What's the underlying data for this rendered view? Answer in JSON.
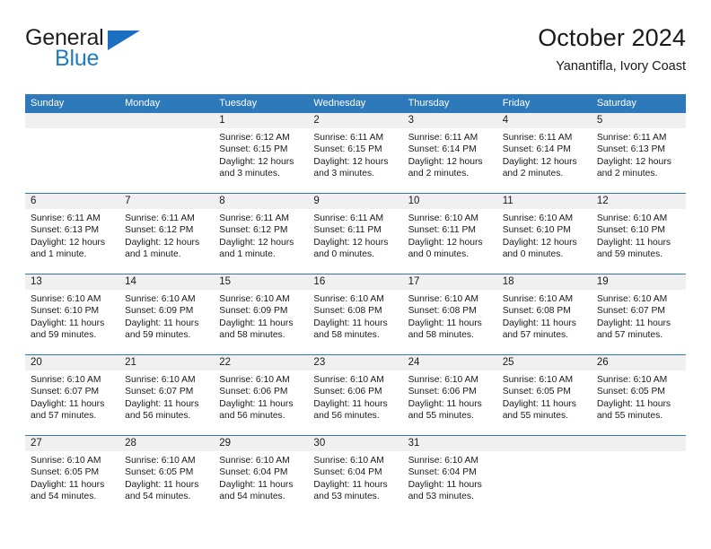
{
  "logo": {
    "word_top": "General",
    "word_bottom": "Blue",
    "triangle_icon": "triangle-icon"
  },
  "header": {
    "title": "October 2024",
    "subtitle": "Yanantifla, Ivory Coast"
  },
  "colors": {
    "header_blue": "#2e79b9",
    "logo_blue": "#1f7cc4",
    "day_band_gray": "#f0f0f0",
    "text": "#1a1a1a"
  },
  "weekdays": [
    "Sunday",
    "Monday",
    "Tuesday",
    "Wednesday",
    "Thursday",
    "Friday",
    "Saturday"
  ],
  "labels": {
    "sunrise_prefix": "Sunrise:",
    "sunset_prefix": "Sunset:",
    "daylight_prefix": "Daylight:"
  },
  "weeks": [
    [
      {
        "day": "",
        "lines": []
      },
      {
        "day": "",
        "lines": []
      },
      {
        "day": "1",
        "lines": [
          "Sunrise: 6:12 AM",
          "Sunset: 6:15 PM",
          "Daylight: 12 hours",
          "and 3 minutes."
        ]
      },
      {
        "day": "2",
        "lines": [
          "Sunrise: 6:11 AM",
          "Sunset: 6:15 PM",
          "Daylight: 12 hours",
          "and 3 minutes."
        ]
      },
      {
        "day": "3",
        "lines": [
          "Sunrise: 6:11 AM",
          "Sunset: 6:14 PM",
          "Daylight: 12 hours",
          "and 2 minutes."
        ]
      },
      {
        "day": "4",
        "lines": [
          "Sunrise: 6:11 AM",
          "Sunset: 6:14 PM",
          "Daylight: 12 hours",
          "and 2 minutes."
        ]
      },
      {
        "day": "5",
        "lines": [
          "Sunrise: 6:11 AM",
          "Sunset: 6:13 PM",
          "Daylight: 12 hours",
          "and 2 minutes."
        ]
      }
    ],
    [
      {
        "day": "6",
        "lines": [
          "Sunrise: 6:11 AM",
          "Sunset: 6:13 PM",
          "Daylight: 12 hours",
          "and 1 minute."
        ]
      },
      {
        "day": "7",
        "lines": [
          "Sunrise: 6:11 AM",
          "Sunset: 6:12 PM",
          "Daylight: 12 hours",
          "and 1 minute."
        ]
      },
      {
        "day": "8",
        "lines": [
          "Sunrise: 6:11 AM",
          "Sunset: 6:12 PM",
          "Daylight: 12 hours",
          "and 1 minute."
        ]
      },
      {
        "day": "9",
        "lines": [
          "Sunrise: 6:11 AM",
          "Sunset: 6:11 PM",
          "Daylight: 12 hours",
          "and 0 minutes."
        ]
      },
      {
        "day": "10",
        "lines": [
          "Sunrise: 6:10 AM",
          "Sunset: 6:11 PM",
          "Daylight: 12 hours",
          "and 0 minutes."
        ]
      },
      {
        "day": "11",
        "lines": [
          "Sunrise: 6:10 AM",
          "Sunset: 6:10 PM",
          "Daylight: 12 hours",
          "and 0 minutes."
        ]
      },
      {
        "day": "12",
        "lines": [
          "Sunrise: 6:10 AM",
          "Sunset: 6:10 PM",
          "Daylight: 11 hours",
          "and 59 minutes."
        ]
      }
    ],
    [
      {
        "day": "13",
        "lines": [
          "Sunrise: 6:10 AM",
          "Sunset: 6:10 PM",
          "Daylight: 11 hours",
          "and 59 minutes."
        ]
      },
      {
        "day": "14",
        "lines": [
          "Sunrise: 6:10 AM",
          "Sunset: 6:09 PM",
          "Daylight: 11 hours",
          "and 59 minutes."
        ]
      },
      {
        "day": "15",
        "lines": [
          "Sunrise: 6:10 AM",
          "Sunset: 6:09 PM",
          "Daylight: 11 hours",
          "and 58 minutes."
        ]
      },
      {
        "day": "16",
        "lines": [
          "Sunrise: 6:10 AM",
          "Sunset: 6:08 PM",
          "Daylight: 11 hours",
          "and 58 minutes."
        ]
      },
      {
        "day": "17",
        "lines": [
          "Sunrise: 6:10 AM",
          "Sunset: 6:08 PM",
          "Daylight: 11 hours",
          "and 58 minutes."
        ]
      },
      {
        "day": "18",
        "lines": [
          "Sunrise: 6:10 AM",
          "Sunset: 6:08 PM",
          "Daylight: 11 hours",
          "and 57 minutes."
        ]
      },
      {
        "day": "19",
        "lines": [
          "Sunrise: 6:10 AM",
          "Sunset: 6:07 PM",
          "Daylight: 11 hours",
          "and 57 minutes."
        ]
      }
    ],
    [
      {
        "day": "20",
        "lines": [
          "Sunrise: 6:10 AM",
          "Sunset: 6:07 PM",
          "Daylight: 11 hours",
          "and 57 minutes."
        ]
      },
      {
        "day": "21",
        "lines": [
          "Sunrise: 6:10 AM",
          "Sunset: 6:07 PM",
          "Daylight: 11 hours",
          "and 56 minutes."
        ]
      },
      {
        "day": "22",
        "lines": [
          "Sunrise: 6:10 AM",
          "Sunset: 6:06 PM",
          "Daylight: 11 hours",
          "and 56 minutes."
        ]
      },
      {
        "day": "23",
        "lines": [
          "Sunrise: 6:10 AM",
          "Sunset: 6:06 PM",
          "Daylight: 11 hours",
          "and 56 minutes."
        ]
      },
      {
        "day": "24",
        "lines": [
          "Sunrise: 6:10 AM",
          "Sunset: 6:06 PM",
          "Daylight: 11 hours",
          "and 55 minutes."
        ]
      },
      {
        "day": "25",
        "lines": [
          "Sunrise: 6:10 AM",
          "Sunset: 6:05 PM",
          "Daylight: 11 hours",
          "and 55 minutes."
        ]
      },
      {
        "day": "26",
        "lines": [
          "Sunrise: 6:10 AM",
          "Sunset: 6:05 PM",
          "Daylight: 11 hours",
          "and 55 minutes."
        ]
      }
    ],
    [
      {
        "day": "27",
        "lines": [
          "Sunrise: 6:10 AM",
          "Sunset: 6:05 PM",
          "Daylight: 11 hours",
          "and 54 minutes."
        ]
      },
      {
        "day": "28",
        "lines": [
          "Sunrise: 6:10 AM",
          "Sunset: 6:05 PM",
          "Daylight: 11 hours",
          "and 54 minutes."
        ]
      },
      {
        "day": "29",
        "lines": [
          "Sunrise: 6:10 AM",
          "Sunset: 6:04 PM",
          "Daylight: 11 hours",
          "and 54 minutes."
        ]
      },
      {
        "day": "30",
        "lines": [
          "Sunrise: 6:10 AM",
          "Sunset: 6:04 PM",
          "Daylight: 11 hours",
          "and 53 minutes."
        ]
      },
      {
        "day": "31",
        "lines": [
          "Sunrise: 6:10 AM",
          "Sunset: 6:04 PM",
          "Daylight: 11 hours",
          "and 53 minutes."
        ]
      },
      {
        "day": "",
        "lines": []
      },
      {
        "day": "",
        "lines": []
      }
    ]
  ]
}
